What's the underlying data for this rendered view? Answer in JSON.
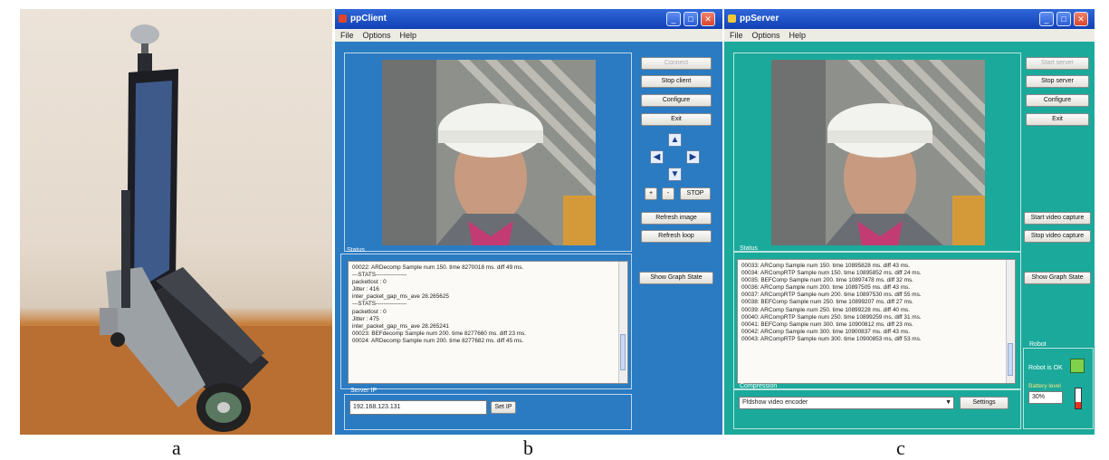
{
  "captions": {
    "a": "a",
    "b": "b",
    "c": "c"
  },
  "client": {
    "title": "ppClient",
    "menu": [
      "File",
      "Options",
      "Help"
    ],
    "buttons": {
      "connect": "Connect",
      "stop": "Stop client",
      "configure": "Configure",
      "exit": "Exit",
      "plus": "+",
      "minus": "-",
      "stopmotion": "STOP",
      "refresh_image": "Refresh image",
      "refresh_loop": "Refresh loop",
      "show_graph": "Show Graph State",
      "set_ip": "Set IP"
    },
    "status_label": "Status",
    "status_lines": [
      "00022: ARDecomp Sample num 150. time 8270018 ms. diff 49 ms.",
      "---STATS----------------",
      "packetlost : 0",
      "Jitter : 416",
      "inter_packet_gap_ms_ave      28.265625",
      "---STATS----------------",
      "packetlost : 0",
      "Jitter : 475",
      "inter_packet_gap_ms_ave      28.265241",
      "00023: BEFdecomp Sample num 200. time 8277660 ms. diff 23 ms.",
      "00024: ARDecomp Sample num 200. time 8277682 ms. diff 45 ms."
    ],
    "server_ip_label": "Server IP",
    "server_ip": "192.168.123.131"
  },
  "server": {
    "title": "ppServer",
    "menu": [
      "File",
      "Options",
      "Help"
    ],
    "buttons": {
      "start": "Start server",
      "stop": "Stop server",
      "configure": "Configure",
      "exit": "Exit",
      "start_capture": "Start video capture",
      "stop_capture": "Stop video capture",
      "show_graph": "Show Graph State",
      "settings": "Settings"
    },
    "status_label": "Status",
    "status_lines": [
      "00033: ARComp Sample num 150. time 10895828 ms. diff 43 ms.",
      "00034: ARCompRTP Sample num 150. time 10895852 ms. diff 24 ms.",
      "00035: BEFComp Sample num 200. time 10897478 ms. diff 32 ms.",
      "00036: ARComp Sample num 200. time 10897505 ms. diff 43 ms.",
      "00037: ARCompRTP Sample num 200. time 10897530 ms. diff 55 ms.",
      "00038: BEFComp Sample num 250. time 10899207 ms. diff 27 ms.",
      "00039: ARComp Sample num 250. time 10899228 ms. diff 40 ms.",
      "00040: ARCompRTP Sample num 250. time 10899259 ms. diff 31 ms.",
      "00041: BEFComp Sample num 300. time 10900812 ms. diff 23 ms.",
      "00042: ARComp Sample num 300. time 10900837 ms. diff 43 ms.",
      "00043: ARCompRTP Sample num 300. time 10900853 ms. diff 53 ms."
    ],
    "compression_label": "Compression",
    "compression_value": "Ffdshow video encoder",
    "robot_label": "Robot",
    "robot_status": "Robot is OK",
    "battery_label": "Battery level",
    "battery_value": "30%",
    "battery_level": 0.3
  },
  "colors": {
    "client_bg": "#2a7bc2",
    "server_bg": "#1ba99b",
    "titlebar": "#1f4fc4"
  }
}
